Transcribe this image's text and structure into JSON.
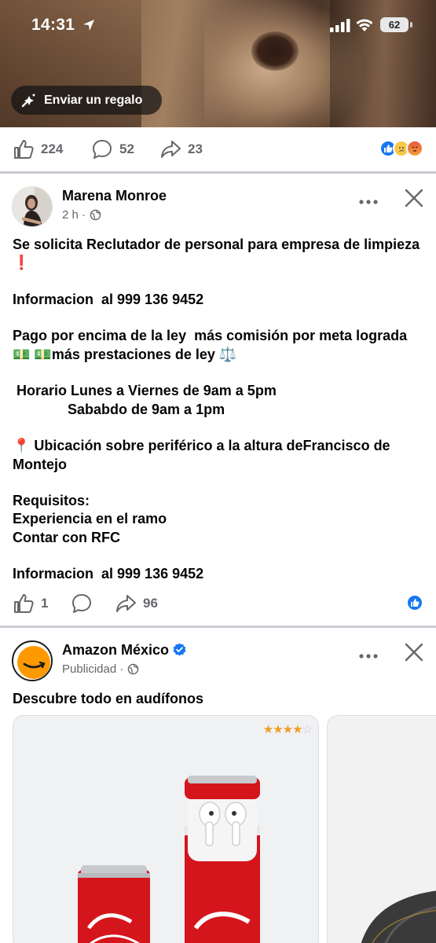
{
  "status": {
    "time": "14:31",
    "battery": "62"
  },
  "video": {
    "gift_label": "Enviar un regalo"
  },
  "top_actions": {
    "likes": "224",
    "comments": "52",
    "shares": "23"
  },
  "post": {
    "author": "Marena Monroe",
    "time": "2 h ·",
    "body": "Se solicita Reclutador de personal para empresa de limpieza ❗\n\nInformacion  al 999 136 9452\n\nPago por encima de la ley  más comisión por meta lograda 💵 💵más prestaciones de ley ⚖️\n\n Horario Lunes a Viernes de 9am a 5pm\n              Sababdo de 9am a 1pm\n\n📍 Ubicación sobre periférico a la altura deFrancisco de Montejo\n\nRequisitos:\nExperiencia en el ramo\nContar con RFC\n\nInformacion  al 999 136 9452",
    "likes": "1",
    "shares": "96"
  },
  "ad": {
    "advertiser": "Amazon México",
    "sponsored": "Publicidad ·",
    "headline": "Descubre todo en audífonos",
    "rating": {
      "filled": "★★★★",
      "empty": "☆",
      "value": 4,
      "max": 5
    }
  },
  "colors": {
    "facebook_blue": "#1877f2",
    "secondary_text": "#65676b",
    "amazon_orange": "#ff9900"
  }
}
